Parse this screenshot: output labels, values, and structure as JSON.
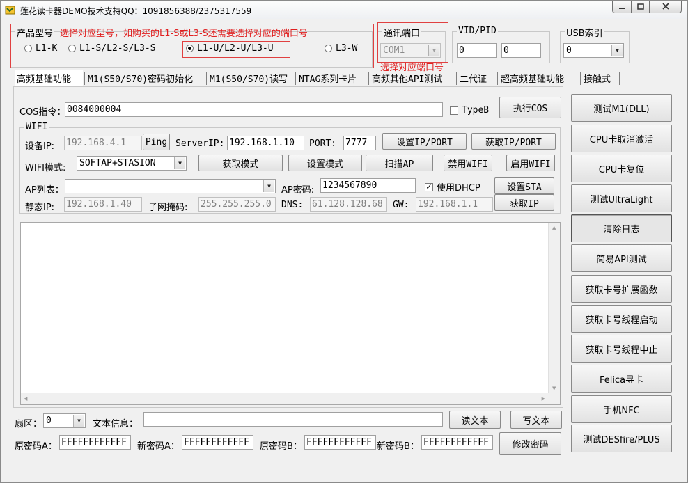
{
  "window": {
    "title": "莲花读卡器DEMO技术支持QQ：1091856388/2375317559"
  },
  "product": {
    "group_label": "产品型号",
    "annotation": "选择对应型号，如购买的L1-S或L3-S还需要选择对应的端口号",
    "options": [
      {
        "label": "L1-K",
        "selected": false
      },
      {
        "label": "L1-S/L2-S/L3-S",
        "selected": false
      },
      {
        "label": "L1-U/L2-U/L3-U",
        "selected": true
      },
      {
        "label": "L3-W",
        "selected": false
      }
    ]
  },
  "port": {
    "group_label": "通讯端口",
    "value": "COM1",
    "annotation": "选择对应端口号"
  },
  "vidpid": {
    "group_label": "VID/PID",
    "vid": "0",
    "pid": "0"
  },
  "usb": {
    "group_label": "USB索引",
    "value": "0"
  },
  "tabs": [
    "高频基础功能",
    "M1(S50/S70)密码初始化",
    "M1(S50/S70)读写",
    "NTAG系列卡片",
    "高频其他API测试",
    "二代证",
    "超高频基础功能",
    "接触式"
  ],
  "cos": {
    "label": "COS指令：",
    "value": "0084000004",
    "typeb_label": "TypeB",
    "exec_label": "执行COS"
  },
  "wifi": {
    "group_label": "WIFI",
    "device_ip_label": "设备IP:",
    "device_ip": "192.168.4.1",
    "ping_label": "Ping",
    "server_ip_label": "ServerIP:",
    "server_ip": "192.168.1.10",
    "port_label": "PORT:",
    "port": "7777",
    "set_ipport_label": "设置IP/PORT",
    "get_ipport_label": "获取IP/PORT",
    "mode_label": "WIFI模式:",
    "mode_value": "SOFTAP+STASION",
    "get_mode_label": "获取模式",
    "set_mode_label": "设置模式",
    "scan_ap_label": "扫描AP",
    "disable_wifi_label": "禁用WIFI",
    "enable_wifi_label": "启用WIFI",
    "ap_list_label": "AP列表：",
    "ap_list_value": "",
    "ap_password_label": "AP密码:",
    "ap_password": "1234567890",
    "dhcp_label": "使用DHCP",
    "dhcp_checked": true,
    "set_sta_label": "设置STA",
    "static_ip_label": "静态IP:",
    "static_ip": "192.168.1.40",
    "subnet_label": "子网掩码:",
    "subnet": "255.255.255.0",
    "dns_label": "DNS:",
    "dns": "61.128.128.68",
    "gw_label": "GW:",
    "gw": "192.168.1.1",
    "get_ip_label": "获取IP"
  },
  "log": {
    "content": ""
  },
  "bottom": {
    "sector_label": "扇区：",
    "sector_value": "0",
    "text_info_label": "文本信息：",
    "text_info_value": "",
    "read_text_label": "读文本",
    "write_text_label": "写文本",
    "old_key_a_label": "原密码A：",
    "old_key_a": "FFFFFFFFFFFF",
    "new_key_a_label": "新密码A：",
    "new_key_a": "FFFFFFFFFFFF",
    "old_key_b_label": "原密码B：",
    "old_key_b": "FFFFFFFFFFFF",
    "new_key_b_label": "新密码B：",
    "new_key_b": "FFFFFFFFFFFF",
    "change_key_label": "修改密码"
  },
  "side_buttons": [
    "测试M1(DLL)",
    "CPU卡取消激活",
    "CPU卡复位",
    "测试UltraLight",
    "清除日志",
    "简易API测试",
    "获取卡号扩展函数",
    "获取卡号线程启动",
    "获取卡号线程中止",
    "Felica寻卡",
    "手机NFC",
    "测试DESfire/PLUS"
  ]
}
